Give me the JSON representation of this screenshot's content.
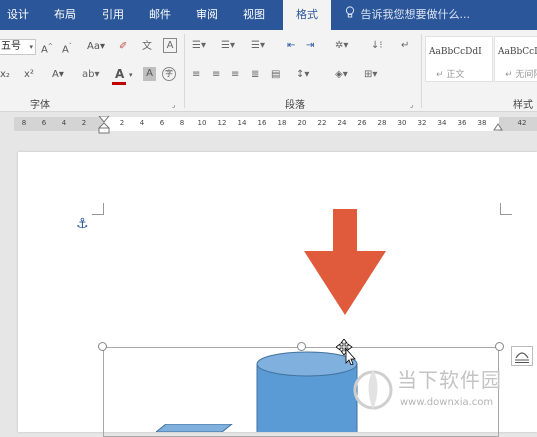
{
  "tabs": [
    "设计",
    "布局",
    "引用",
    "邮件",
    "审阅",
    "视图",
    "格式"
  ],
  "active_tab": "格式",
  "tell_me": "告诉我您想要做什么...",
  "font": {
    "size_value": "五号",
    "group_label": "字体"
  },
  "paragraph": {
    "group_label": "段落"
  },
  "styles": {
    "group_label": "样式",
    "items": [
      {
        "sample": "AaBbCcDdI",
        "name": "正文"
      },
      {
        "sample": "AaBbCcI",
        "name": "无间隔"
      }
    ]
  },
  "ruler": {
    "left_numbers": [
      "8",
      "6",
      "4",
      "2"
    ],
    "right_numbers": [
      "2",
      "4",
      "6",
      "8",
      "10",
      "12",
      "14",
      "16",
      "18",
      "20",
      "22",
      "24",
      "26",
      "28",
      "30",
      "32",
      "34",
      "36",
      "38",
      "42"
    ]
  },
  "icons": {
    "tell_me": "lightbulb-icon",
    "anchor": "anchor-icon",
    "layout_options": "layout-options-icon",
    "move_cursor": "move-cursor-icon",
    "down_arrow": "down-arrow-shape",
    "cylinder": "cylinder-shape",
    "cube": "cube-shape"
  },
  "watermark": {
    "name": "当下软件园",
    "url": "www.downxia.com"
  },
  "colors": {
    "ribbon_blue": "#2b579a",
    "arrow": "#e05a3c",
    "shape_fill": "#5b9bd5",
    "font_color_bar": "#c00000"
  }
}
